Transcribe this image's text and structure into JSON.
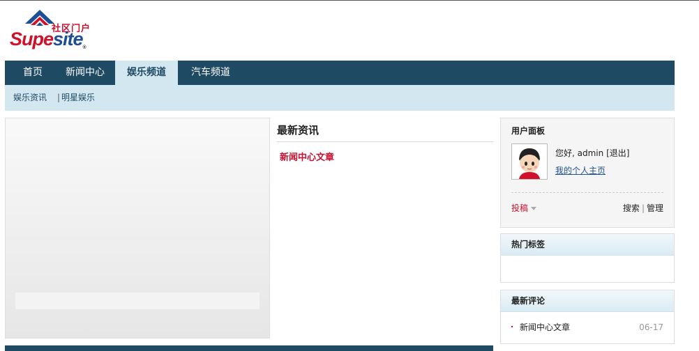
{
  "logo": {
    "subtitle": "社区门户",
    "brand_part1": "Supe",
    "brand_part2": "site",
    "reg_mark": "®"
  },
  "nav": {
    "items": [
      {
        "label": "首页"
      },
      {
        "label": "新闻中心"
      },
      {
        "label": "娱乐频道",
        "active": true
      },
      {
        "label": "汽车频道"
      }
    ]
  },
  "subnav": {
    "items": [
      {
        "label": "娱乐资讯"
      },
      {
        "label": "明星娱乐"
      }
    ],
    "separator": "|"
  },
  "latest": {
    "title": "最新资讯",
    "articles": [
      {
        "title": "新闻中心文章"
      }
    ]
  },
  "user_panel": {
    "title": "用户面板",
    "greeting": "您好, admin",
    "logout": "[退出]",
    "homepage_link": "我的个人主页",
    "post_label": "投稿",
    "search_label": "搜索",
    "tools_separator": "|",
    "manage_label": "管理"
  },
  "hot_tags": {
    "title": "热门标签"
  },
  "latest_comments": {
    "title": "最新评论",
    "items": [
      {
        "title": "新闻中心文章",
        "date": "06-17"
      }
    ]
  },
  "colors": {
    "nav_bg": "#1e4a63",
    "subnav_bg": "#d3e7f0",
    "accent_red": "#c8102e",
    "brand_blue": "#1d4f94"
  }
}
